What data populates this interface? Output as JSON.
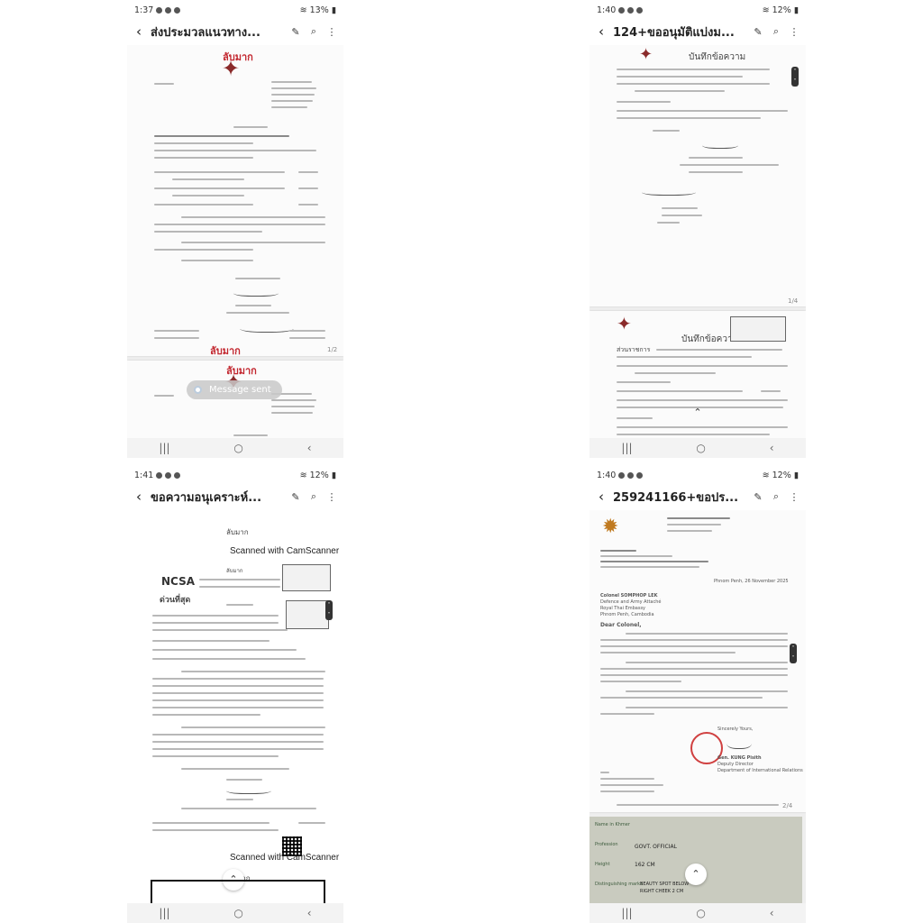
{
  "screens": [
    {
      "status": {
        "time": "1:37",
        "battery": "13%"
      },
      "title": "ส่งประมวลแนวทาง...",
      "doc1": {
        "top_red": "ลับมาก",
        "bottom_red": "ลับมาก",
        "page": "1/2"
      },
      "doc2": {
        "top_red": "ลับมาก"
      },
      "toast": "Message sent"
    },
    {
      "status": {
        "time": "1:40",
        "battery": "12%"
      },
      "title": "124+ขออนุมัติแบ่งม...",
      "doc1": {
        "heading": "บันทึกข้อความ",
        "page": "1/4"
      },
      "doc2": {
        "heading": "บันทึกข้อความ",
        "label": "ส่วนราชการ"
      }
    },
    {
      "status": {
        "time": "1:41",
        "battery": "12%"
      },
      "title": "ขอความอนุเคราะห์...",
      "doc1": {
        "top": "ลับมาก",
        "camscanner": "Scanned with CamScanner",
        "logo": "NCSA",
        "urgent": "ด่วนที่สุด",
        "bottom": "ลับมาก"
      },
      "camscanner2": "Scanned with CamScanner"
    },
    {
      "status": {
        "time": "1:40",
        "battery": "12%"
      },
      "title": "259241166+ขอปร...",
      "letter": {
        "date": "Phnom Penh, 26 November 2025",
        "addressee": "Colonel SOMPHOP LEK",
        "line2": "Defence and Army Attaché",
        "line3": "Royal Thai Embassy",
        "line4": "Phnom Penh, Cambodia",
        "salutation": "Dear Colonel,",
        "closing": "Sincerely Yours,",
        "signer": "Gen. KUNG Pisith",
        "signer_title": "Deputy Director",
        "department": "Department of International Relations",
        "page": "2/4"
      },
      "idcard": {
        "label1": "Name in Khmer",
        "label2": "Profession",
        "value2": "GOVT. OFFICIAL",
        "label3": "Height",
        "value3": "162 CM",
        "label4": "Distinguishing marks",
        "value4": "BEAUTY SPOT BELOW",
        "value5": "RIGHT CHEEK 2 CM"
      }
    }
  ],
  "icons": {
    "back": "back-arrow-icon",
    "edit": "edit-icon",
    "search": "search-icon",
    "more": "more-vert-icon"
  },
  "colors": {
    "red": "#c2262e",
    "nav": "#f3f3f3"
  }
}
